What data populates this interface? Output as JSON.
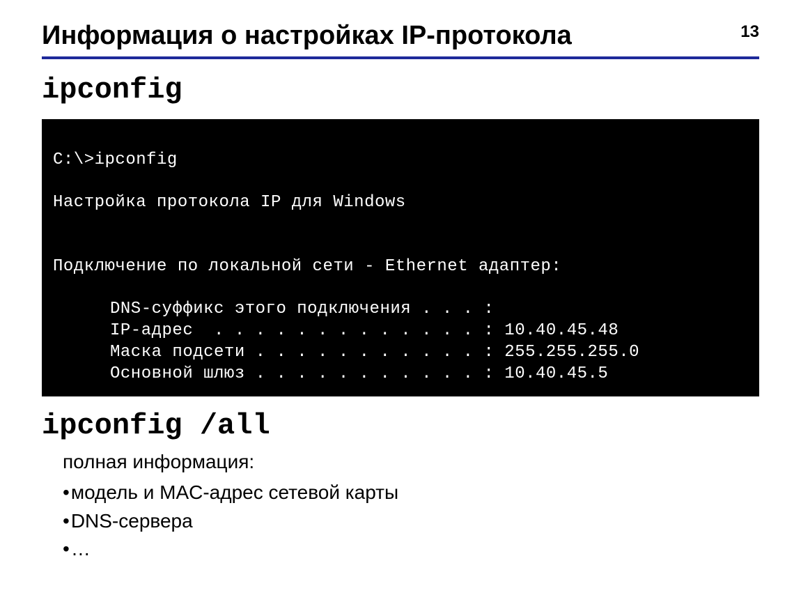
{
  "header": {
    "title": "Информация о настройках IP-протокола",
    "page_number": "13"
  },
  "command1": {
    "label": "ipconfig"
  },
  "terminal": {
    "prompt": "C:\\>ipconfig",
    "line1": "Настройка протокола IP для Windows",
    "line2": "Подключение по локальной сети - Ethernet адаптер:",
    "row_dns": "DNS-суффикс этого подключения . . . :",
    "row_ip": "IP-адрес  . . . . . . . . . . . . . : 10.40.45.48",
    "row_mask": "Маска подсети . . . . . . . . . . . : 255.255.255.0",
    "row_gateway": "Основной шлюз . . . . . . . . . . . : 10.40.45.5"
  },
  "command2": {
    "label": "ipconfig /all"
  },
  "info": {
    "intro": "полная информация:",
    "b1": "модель и MAC-адрес сетевой карты",
    "b2": "DNS-сервера",
    "b3": "…"
  }
}
